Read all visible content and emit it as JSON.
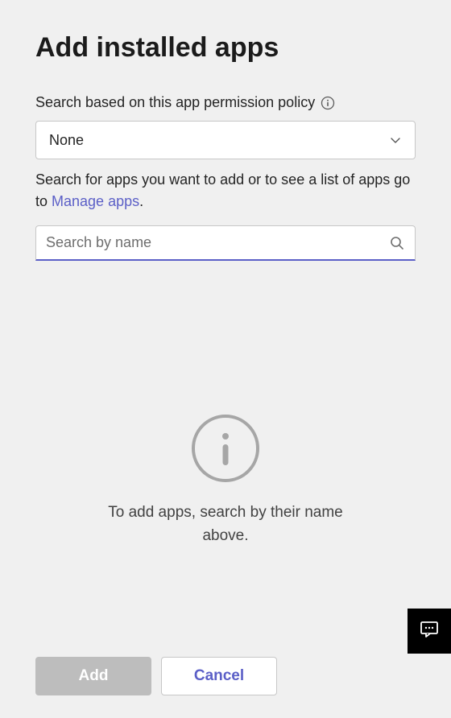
{
  "title": "Add installed apps",
  "policyField": {
    "label": "Search based on this app permission policy",
    "value": "None"
  },
  "helperText": {
    "prefix": "Search for apps you want to add or to see a list of apps go to ",
    "linkText": "Manage apps",
    "suffix": "."
  },
  "search": {
    "placeholder": "Search by name"
  },
  "emptyState": {
    "text": "To add apps, search by their name above."
  },
  "buttons": {
    "add": "Add",
    "cancel": "Cancel"
  }
}
